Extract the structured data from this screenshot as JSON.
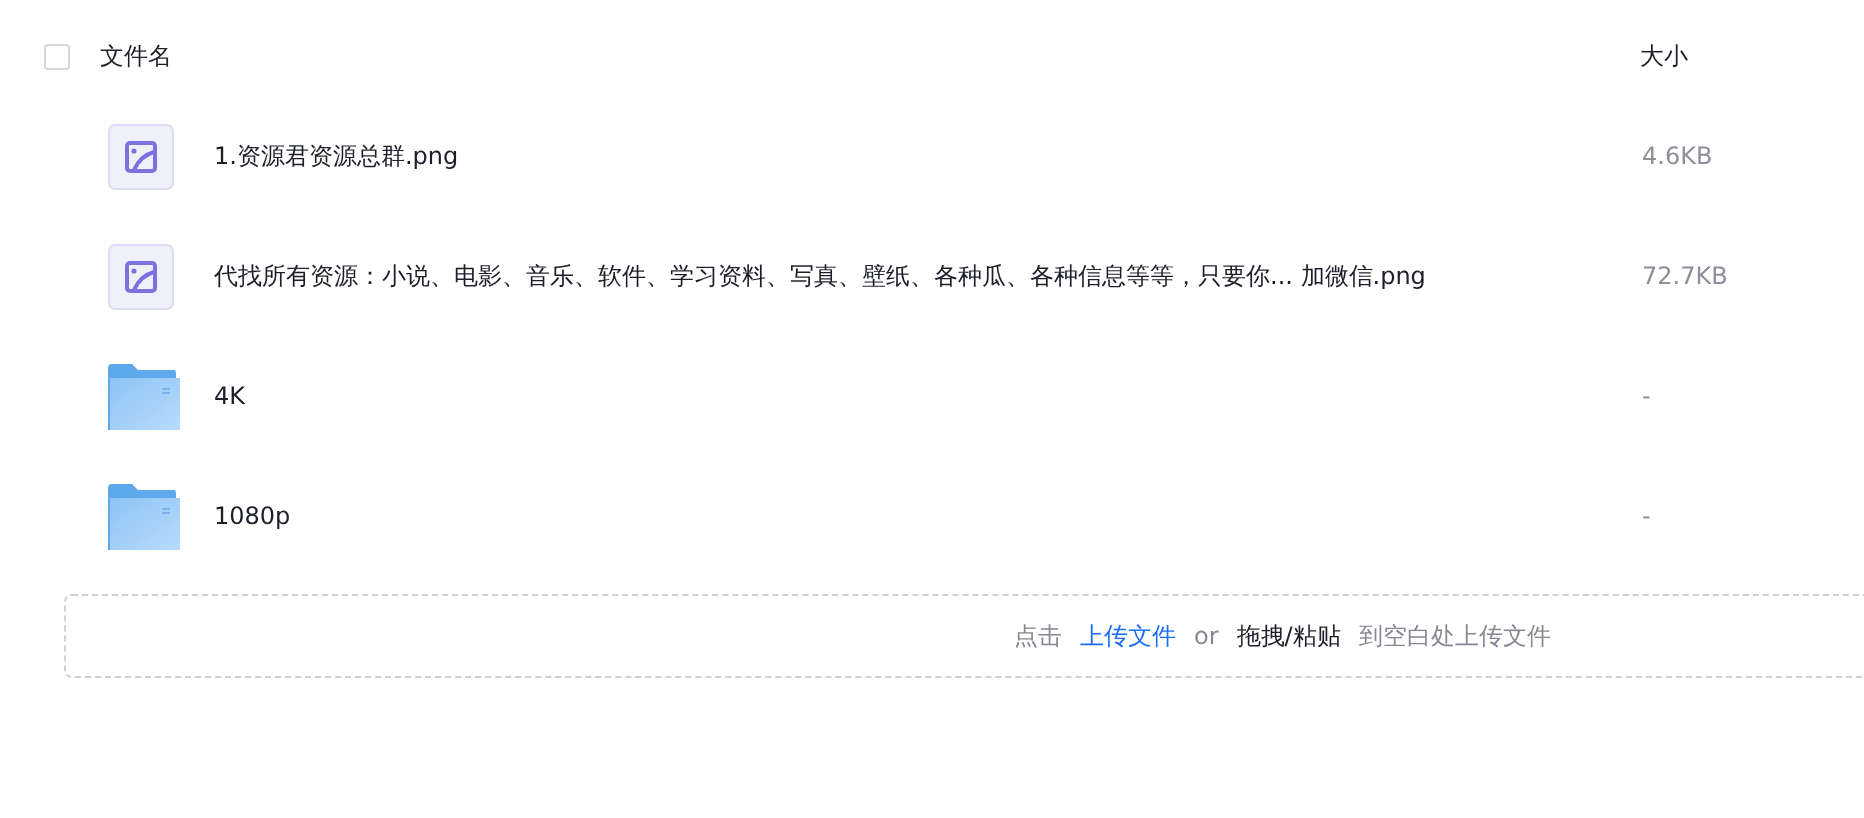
{
  "table": {
    "select_all": {
      "checked": false
    },
    "columns": [
      "文件名",
      "大小"
    ],
    "rows": [
      {
        "kind": "image",
        "name": "1.资源君资源总群.png",
        "size": "4.6KB"
      },
      {
        "kind": "image",
        "name": "代找所有资源：小说、电影、音乐、软件、学习资料、写真、壁纸、各种瓜、各种信息等等，只要你...  加微信.png",
        "size": "72.7KB"
      },
      {
        "kind": "folder",
        "name": "4K",
        "size": "-"
      },
      {
        "kind": "folder",
        "name": "1080p",
        "size": "-"
      }
    ]
  },
  "upload": {
    "prefix": "点击",
    "link": "上传文件",
    "or": "or",
    "action": "拖拽/粘贴",
    "suffix": "到空白处上传文件"
  }
}
